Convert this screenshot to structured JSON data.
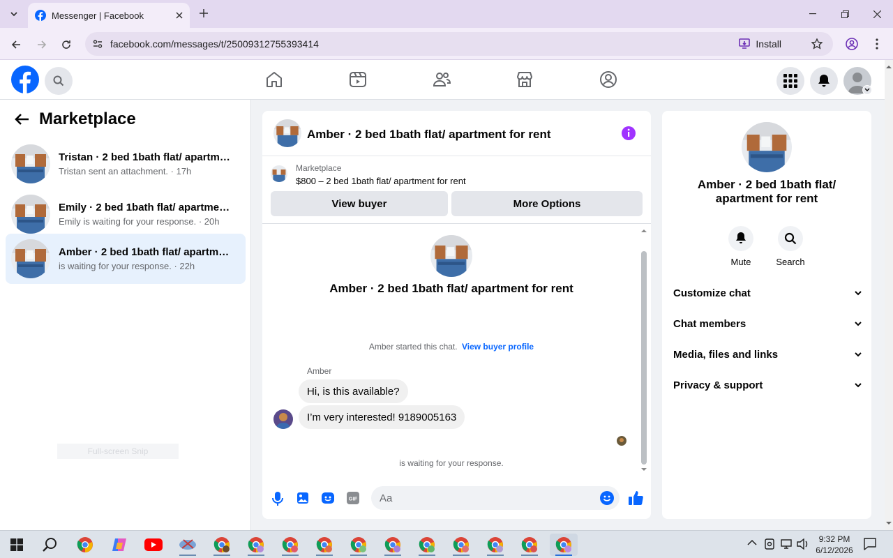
{
  "browser": {
    "tab_title": "Messenger | Facebook",
    "url": "facebook.com/messages/t/25009312755393414",
    "install_label": "Install"
  },
  "left": {
    "title": "Marketplace",
    "conversations": [
      {
        "name": "Tristan · 2 bed 1bath flat/ apartme...",
        "preview": "Tristan sent an attachment. · 17h"
      },
      {
        "name": "Emily · 2 bed 1bath flat/ apartmen...",
        "preview": "Emily is waiting for your response. · 20h"
      },
      {
        "name": "Amber · 2 bed 1bath flat/ apartme...",
        "preview": "is waiting for your response. · 22h"
      }
    ],
    "ghost_text": "Full-screen Snip"
  },
  "chat": {
    "title": "Amber · 2 bed 1bath flat/ apartment for rent",
    "marketplace_label": "Marketplace",
    "listing": "$800 – 2 bed 1bath flat/ apartment for rent",
    "view_buyer": "View buyer",
    "more_options": "More Options",
    "intro_title": "Amber · 2 bed 1bath flat/ apartment for rent",
    "started_text": "Amber started this chat.",
    "view_profile": "View buyer profile",
    "sender": "Amber",
    "messages": [
      "Hi, is this available?",
      "I’m very interested! 9189005163"
    ],
    "waiting": "is waiting for your response.",
    "composer_placeholder": "Aa"
  },
  "info": {
    "title": "Amber · 2 bed 1bath flat/ apartment for rent",
    "mute": "Mute",
    "search": "Search",
    "sections": [
      "Customize chat",
      "Chat members",
      "Media, files and links",
      "Privacy & support"
    ]
  },
  "taskbar": {
    "time": "9:32 PM",
    "date": "6/12/2026"
  },
  "colors": {
    "fb_blue": "#0866ff",
    "accent_purple": "#a033ff",
    "selected_bg": "#e7f1fd"
  }
}
